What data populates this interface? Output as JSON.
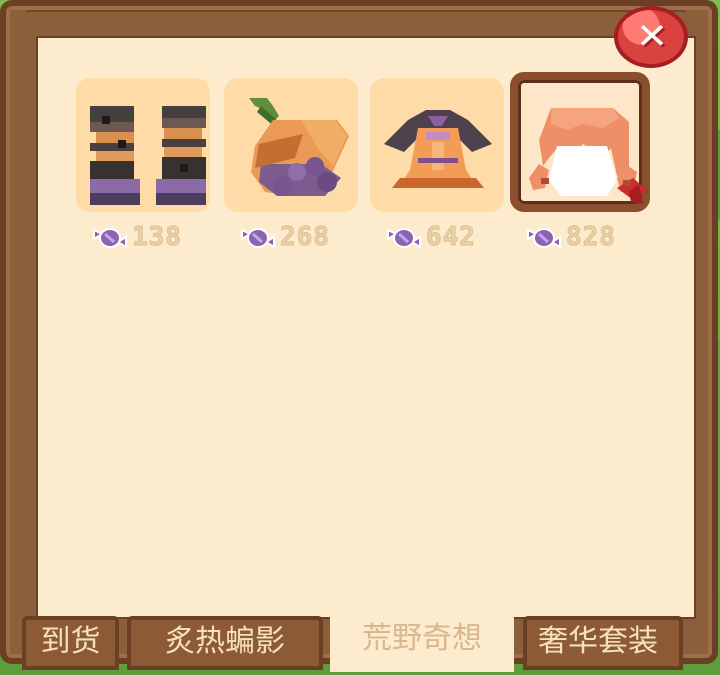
{
  "shop": {
    "items": [
      {
        "name": "boots",
        "price": "138"
      },
      {
        "name": "carrot",
        "price": "268"
      },
      {
        "name": "dress",
        "price": "642"
      },
      {
        "name": "hair",
        "price": "828",
        "selected": true
      }
    ],
    "tabs": [
      {
        "label": "到货",
        "active": false
      },
      {
        "label": "炙热蝙影",
        "active": false
      },
      {
        "label": "荒野奇想",
        "active": true
      },
      {
        "label": "奢华套装",
        "active": false
      }
    ],
    "close_icon": "close-icon",
    "currency_icon": "candy-icon"
  },
  "colors": {
    "panel": "#fdebcd",
    "frame": "#8b5f3b",
    "accent": "#d9423e",
    "price": "#ead1a8"
  }
}
